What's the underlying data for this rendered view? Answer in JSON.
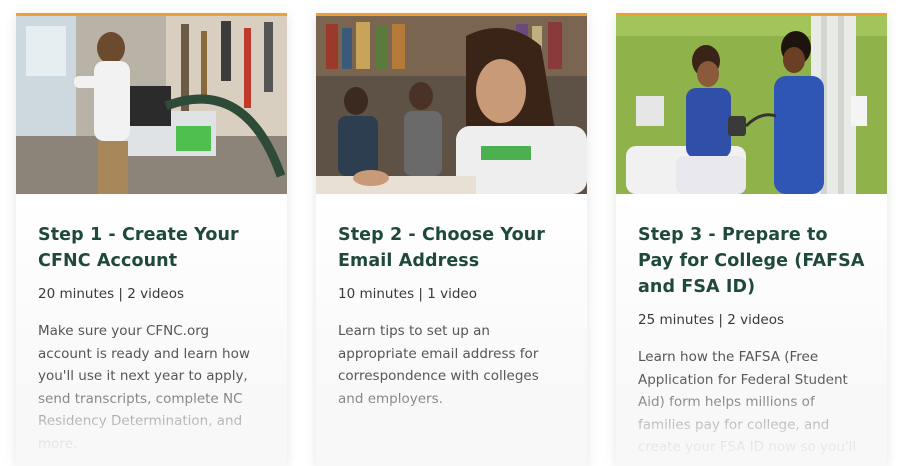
{
  "cards": [
    {
      "title": "Step 1 - Create Your CFNC Account",
      "meta": "20 minutes | 2 videos",
      "description": "Make sure your CFNC.org account is ready and learn how you'll use it next year to apply, send transcripts, complete NC Residency Determination, and more.",
      "image": "student-using-miter-saw-photo"
    },
    {
      "title": "Step 2 - Choose Your Email Address",
      "meta": "10 minutes | 1 video",
      "description": "Learn tips to set up an appropriate email address for correspondence with colleges and employers.",
      "image": "student-writing-in-library-photo"
    },
    {
      "title": "Step 3 - Prepare to Pay for College (FAFSA and FSA ID)",
      "meta": "25 minutes | 2 videos",
      "description": "Learn how the FAFSA (Free Application for Federal Student Aid) form helps millions of families pay for college, and create your FSA ID now so you'll",
      "image": "nursing-students-taking-blood-pressure-photo"
    }
  ],
  "colors": {
    "accent_bar": "#f0a033",
    "title": "#1f4a3a"
  }
}
